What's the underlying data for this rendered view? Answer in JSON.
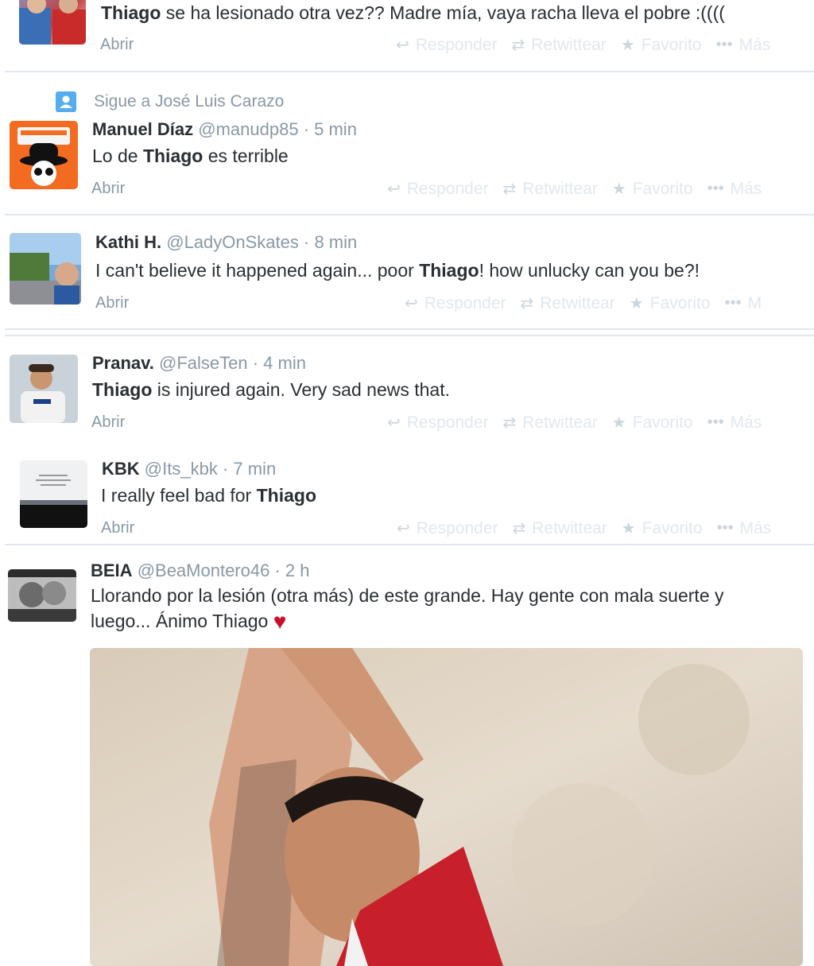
{
  "common": {
    "open": "Abrir",
    "reply": "Responder",
    "retweet": "Retwittear",
    "favorite": "Favorito",
    "more": "Más",
    "more_cut": "M"
  },
  "t0": {
    "bold": "Thiago",
    "text": " se ha lesionado otra vez?? Madre mía, vaya racha lleva el pobre :(((("
  },
  "follow": {
    "text": "Sigue a José Luis Carazo"
  },
  "t1": {
    "name": "Manuel Díaz",
    "handle": "@manudp85",
    "time": " · 5 min",
    "pre": "Lo de ",
    "bold": "Thiago",
    "post": " es terrible"
  },
  "t2": {
    "name": "Kathi H.",
    "handle": "@LadyOnSkates",
    "time": " · 8 min",
    "pre": "I can't believe it happened again... poor ",
    "bold": "Thiago",
    "post": "! how unlucky can you be?!"
  },
  "t3": {
    "name": "Pranav.",
    "handle": "@FalseTen",
    "time": " · 4 min",
    "bold": "Thiago",
    "post": " is injured again. Very sad news that."
  },
  "t4": {
    "name": "KBK",
    "handle": "@Its_kbk",
    "time": " · 7 min",
    "pre": "I really feel bad for ",
    "bold": "Thiago"
  },
  "t5": {
    "name": "BEIA",
    "handle": "@BeaMontero46",
    "time": " · 2 h",
    "line1": "Llorando por la lesión (otra más) de este grande. Hay gente con mala suerte y",
    "line2": "luego... Ánimo Thiago",
    "heart": "♥"
  },
  "icons": {
    "reply": "reply-icon",
    "retweet": "retweet-icon",
    "favorite": "star-icon",
    "more": "more-dots-icon"
  },
  "colors": {
    "muted": "#8899a6",
    "faint": "#e1e8ed",
    "heart": "#c8102e",
    "follow_icon": "#55acee"
  }
}
